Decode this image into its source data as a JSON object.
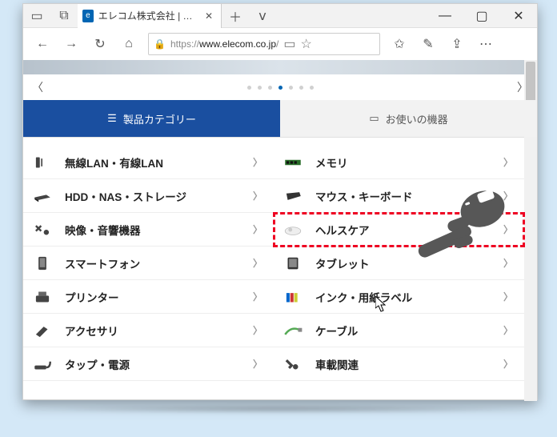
{
  "titlebar": {
    "tab_title": "エレコム株式会社 | ELECC",
    "favicon_text": "e"
  },
  "addr": {
    "scheme": "https://",
    "host": "www.elecom.co.jp",
    "path": "/"
  },
  "tabs2": {
    "active": "製品カテゴリー",
    "inactive": "お使いの機器"
  },
  "categories_left": [
    {
      "label": "無線LAN・有線LAN"
    },
    {
      "label": "HDD・NAS・ストレージ"
    },
    {
      "label": "映像・音響機器"
    },
    {
      "label": "スマートフォン"
    },
    {
      "label": "プリンター"
    },
    {
      "label": "アクセサリ"
    },
    {
      "label": "タップ・電源"
    }
  ],
  "categories_right": [
    {
      "label": "メモリ",
      "highlight": false
    },
    {
      "label": "マウス・キーボード",
      "highlight": false
    },
    {
      "label": "ヘルスケア",
      "highlight": true
    },
    {
      "label": "タブレット",
      "highlight": false
    },
    {
      "label": "インク・用紙ラベル",
      "highlight": false
    },
    {
      "label": "ケーブル",
      "highlight": false
    },
    {
      "label": "車載関連",
      "highlight": false
    }
  ]
}
